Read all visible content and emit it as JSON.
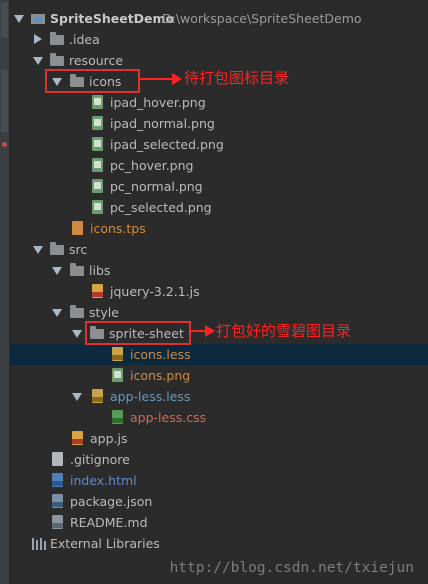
{
  "project": {
    "name": "SpriteSheetDemo",
    "path": "D:\\workspace\\SpriteSheetDemo"
  },
  "tree": [
    {
      "label": "SpriteSheetDemo",
      "type": "project",
      "color": "bold",
      "expanded": true
    },
    {
      "label": ".idea",
      "type": "folder",
      "color": "default",
      "expanded": false
    },
    {
      "label": "resource",
      "type": "folder",
      "color": "default",
      "expanded": true
    },
    {
      "label": "icons",
      "type": "folder",
      "color": "default",
      "expanded": true
    },
    {
      "label": "ipad_hover.png",
      "type": "png",
      "color": "default"
    },
    {
      "label": "ipad_normal.png",
      "type": "png",
      "color": "default"
    },
    {
      "label": "ipad_selected.png",
      "type": "png",
      "color": "default"
    },
    {
      "label": "pc_hover.png",
      "type": "png",
      "color": "default"
    },
    {
      "label": "pc_normal.png",
      "type": "png",
      "color": "default"
    },
    {
      "label": "pc_selected.png",
      "type": "png",
      "color": "default"
    },
    {
      "label": "icons.tps",
      "type": "tps",
      "color": "orange"
    },
    {
      "label": "src",
      "type": "folder",
      "color": "default",
      "expanded": true
    },
    {
      "label": "libs",
      "type": "folder",
      "color": "default",
      "expanded": true
    },
    {
      "label": "jquery-3.2.1.js",
      "type": "js",
      "color": "default"
    },
    {
      "label": "style",
      "type": "folder",
      "color": "default",
      "expanded": true
    },
    {
      "label": "sprite-sheet",
      "type": "folder",
      "color": "default",
      "expanded": true
    },
    {
      "label": "icons.less",
      "type": "less",
      "color": "orange",
      "selected": true
    },
    {
      "label": "icons.png",
      "type": "png",
      "color": "orange"
    },
    {
      "label": "app-less.less",
      "type": "less",
      "color": "blue",
      "expanded": true
    },
    {
      "label": "app-less.css",
      "type": "css",
      "color": "red"
    },
    {
      "label": "app.js",
      "type": "js",
      "color": "default"
    },
    {
      "label": ".gitignore",
      "type": "txt",
      "color": "default"
    },
    {
      "label": "index.html",
      "type": "html",
      "color": "blue2"
    },
    {
      "label": "package.json",
      "type": "json",
      "color": "default"
    },
    {
      "label": "README.md",
      "type": "md",
      "color": "default"
    },
    {
      "label": "External Libraries",
      "type": "libs",
      "color": "default"
    }
  ],
  "annotations": {
    "icons_note": "待打包图标目录",
    "sprite_note": "打包好的雪碧图目录"
  },
  "watermark": "http://blog.csdn.net/txiejun",
  "colors": {
    "background": "#2b2b2b",
    "selected_row": "#0d293e",
    "annotation_red": "#ff2222",
    "orange_text": "#d08a40",
    "blue_text": "#6897bb",
    "red_text": "#cc6a5a"
  }
}
